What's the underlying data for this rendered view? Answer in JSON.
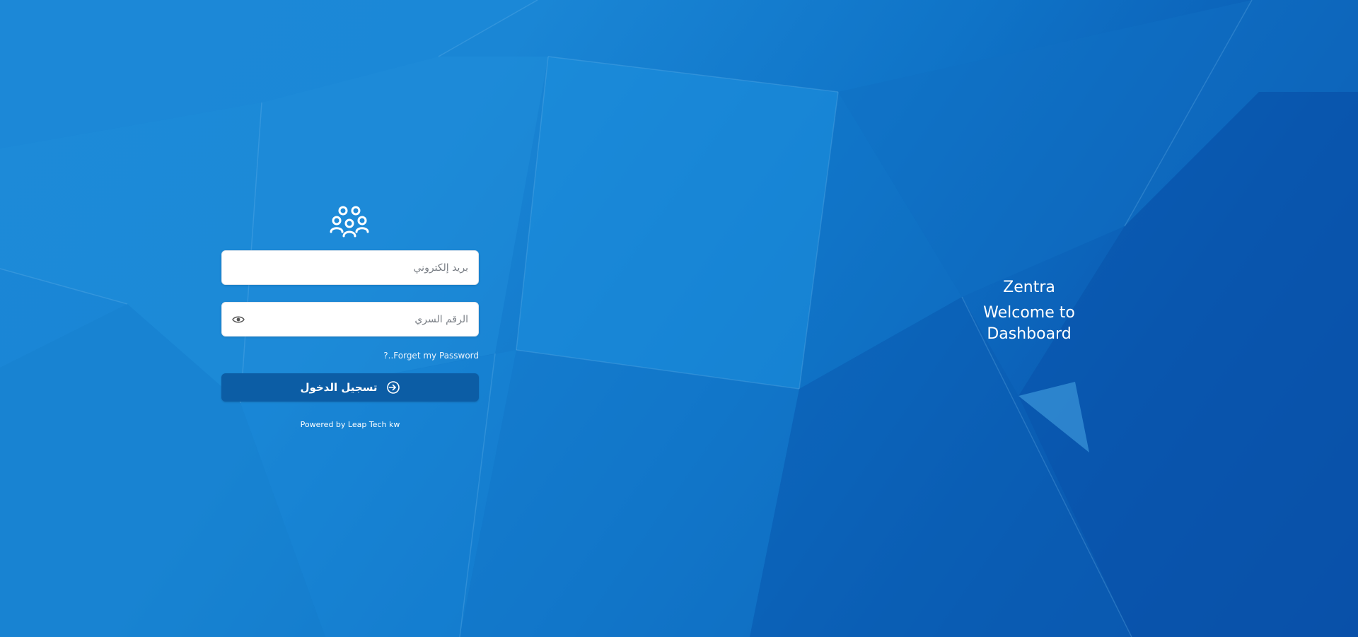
{
  "login": {
    "email_placeholder": "بريد إلكتروني",
    "password_placeholder": "الرقم السري",
    "forgot_password": "?..Forget my Password",
    "login_button_label": "تسجيل الدخول",
    "powered_by": "Powered by Leap Tech kw"
  },
  "welcome": {
    "brand": "Zentra",
    "tagline": "Welcome to Dashboard"
  },
  "icons": {
    "logo": "users-group-icon",
    "password_toggle": "eye-icon",
    "login_button": "sign-in-icon"
  },
  "colors": {
    "background_primary": "#1a86d5",
    "background_dark": "#0a4fa8",
    "button": "#0c5da5",
    "field_background": "#ffffff",
    "text_on_background": "#ffffff"
  }
}
